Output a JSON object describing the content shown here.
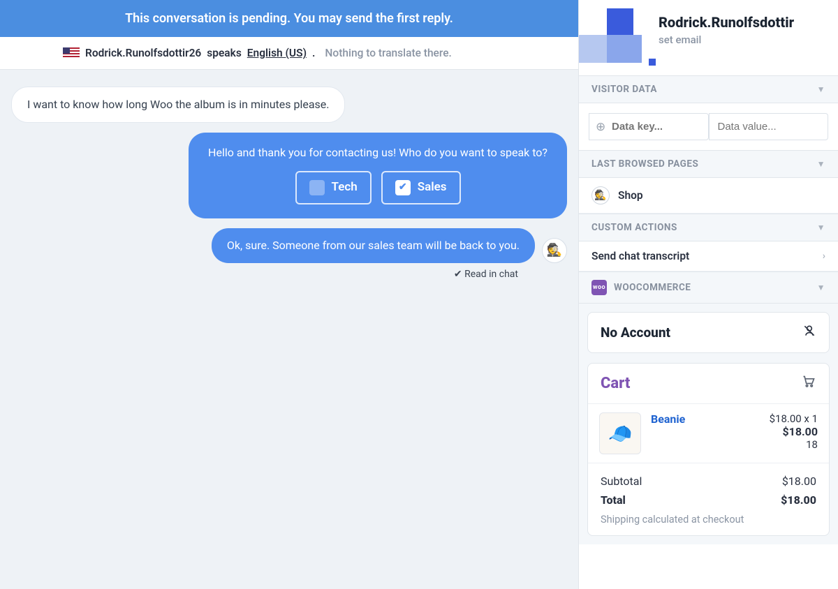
{
  "banner": "This conversation is pending. You may send the first reply.",
  "translate": {
    "name": "Rodrick.Runolfsdottir26",
    "speaks": "speaks",
    "language": "English (US)",
    "note": "Nothing to translate there."
  },
  "messages": {
    "visitor1": "I want to know how long Woo the album is in minutes please.",
    "agent1_text": "Hello and thank you for contacting us! Who do you want to speak to?",
    "choice_tech": "Tech",
    "choice_sales": "Sales",
    "agent2_text": "Ok, sure. Someone from our sales team will be back to you.",
    "read_status": "Read in chat"
  },
  "sidebar": {
    "profile_name": "Rodrick.Runolfsdottir",
    "profile_sub": "set email",
    "sections": {
      "visitor_data": "VISITOR DATA",
      "last_browsed": "LAST BROWSED PAGES",
      "custom_actions": "CUSTOM ACTIONS",
      "woocommerce": "WOOCOMMERCE"
    },
    "data_key_placeholder": "Data key...",
    "data_value_placeholder": "Data value...",
    "browsed_page": "Shop",
    "action_transcript": "Send chat transcript",
    "no_account": "No Account",
    "cart": {
      "title": "Cart",
      "item_name": "Beanie",
      "item_unit": "$18.00 x 1",
      "item_total": "$18.00",
      "item_qty": "18",
      "subtotal_label": "Subtotal",
      "subtotal_value": "$18.00",
      "total_label": "Total",
      "total_value": "$18.00",
      "ship_note": "Shipping calculated at checkout"
    }
  }
}
